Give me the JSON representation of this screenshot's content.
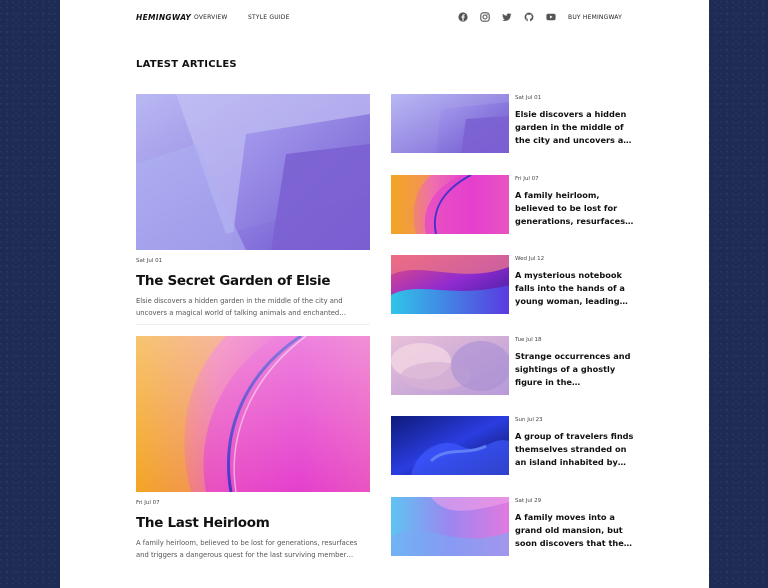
{
  "brand": "HEMINGWAY",
  "nav": {
    "overview": "OVERVIEW",
    "style_guide": "STYLE GUIDE",
    "buy": "BUY HEMINGWAY",
    "social_icons": [
      "facebook-icon",
      "instagram-icon",
      "twitter-icon",
      "github-icon",
      "youtube-icon"
    ]
  },
  "section_title": "LATEST ARTICLES",
  "featured": [
    {
      "date": "Sat Jul 01",
      "title": "The Secret Garden of Elsie",
      "excerpt_line1": "Elsie discovers a hidden garden in the middle of the city and",
      "excerpt_line2": "uncovers a magical world of talking animals and enchanted…"
    },
    {
      "date": "Fri Jul 07",
      "title": "The Last Heirloom",
      "excerpt_line1": "A family heirloom, believed to be lost for generations, resurfaces",
      "excerpt_line2": "and triggers a dangerous quest for the last surviving member…"
    }
  ],
  "side_articles": [
    {
      "date": "Sat Jul 01",
      "title": "Elsie discovers a hidden garden in the middle of the city and uncovers a…"
    },
    {
      "date": "Fri Jul 07",
      "title": "A family heirloom, believed to be lost for generations, resurfaces…"
    },
    {
      "date": "Wed Jul 12",
      "title": "A mysterious notebook falls into the hands of a young woman, leading…"
    },
    {
      "date": "Tue Jul 18",
      "title": "Strange occurrences and sightings of a ghostly figure in the…"
    },
    {
      "date": "Sun Jul 23",
      "title": "A group of travelers finds themselves stranded on an island inhabited by…"
    },
    {
      "date": "Sat Jul 29",
      "title": "A family moves into a grand old mansion, but soon discovers that the…"
    }
  ]
}
